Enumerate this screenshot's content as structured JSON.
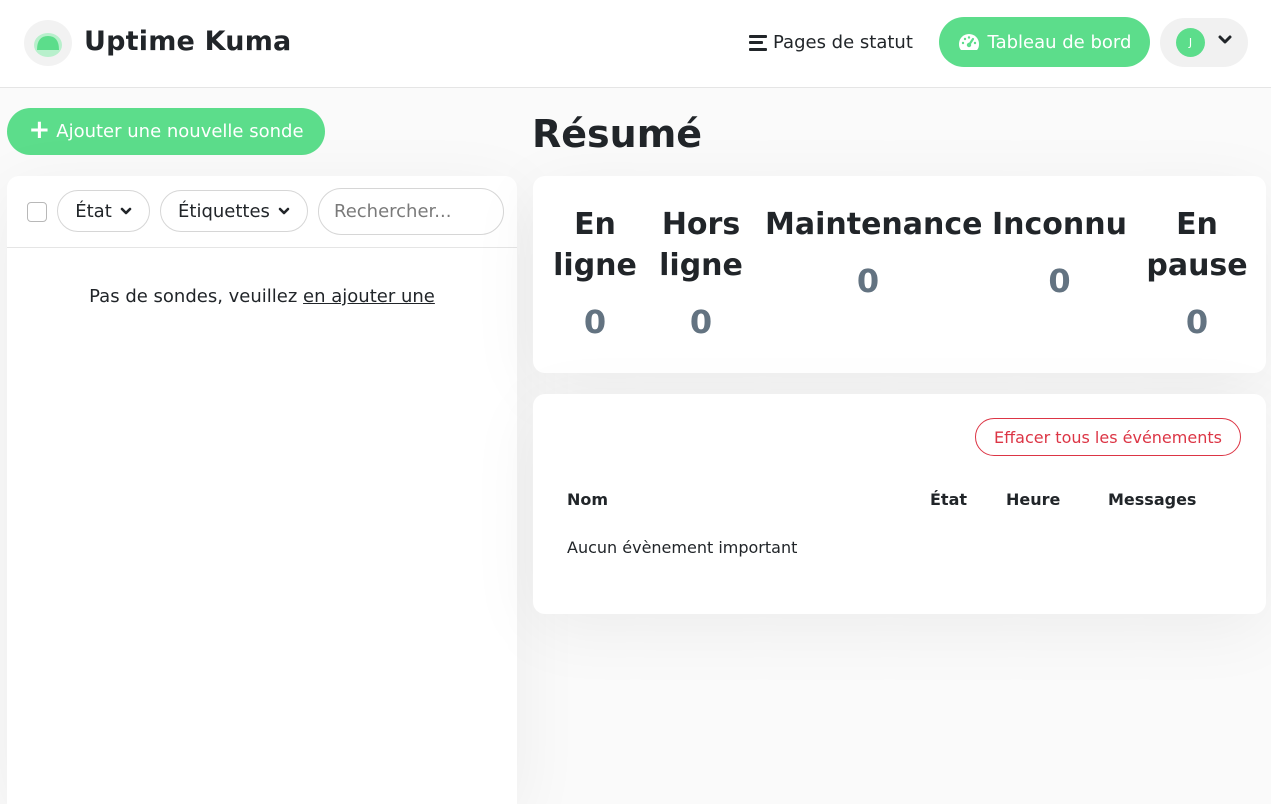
{
  "header": {
    "app_title": "Uptime Kuma",
    "status_pages_label": "Pages de statut",
    "dashboard_label": "Tableau de bord",
    "avatar_initial": "J"
  },
  "sidebar": {
    "add_monitor_label": "Ajouter une nouvelle sonde",
    "filter_state_label": "État",
    "filter_tags_label": "Étiquettes",
    "search_placeholder": "Rechercher...",
    "empty_text": "Pas de sondes, veuillez ",
    "empty_link": "en ajouter une"
  },
  "summary": {
    "title": "Résumé",
    "stats": [
      {
        "label_line1": "En",
        "label_line2": "ligne",
        "value": "0"
      },
      {
        "label_line1": "Hors",
        "label_line2": "ligne",
        "value": "0"
      },
      {
        "label_line1": "Maintenance",
        "label_line2": "",
        "value": "0"
      },
      {
        "label_line1": "Inconnu",
        "label_line2": "",
        "value": "0"
      },
      {
        "label_line1": "En",
        "label_line2": "pause",
        "value": "0"
      }
    ]
  },
  "events": {
    "clear_label": "Effacer tous les événements",
    "columns": [
      "Nom",
      "État",
      "Heure",
      "Messages"
    ],
    "empty_text": "Aucun évènement important"
  },
  "colors": {
    "primary": "#5cdd8b",
    "danger": "#dc3545",
    "stat_value": "#637381"
  },
  "icons": {
    "logo": "uptime-kuma-logo",
    "status_pages": "list-icon",
    "dashboard": "tachometer-icon",
    "profile_chevron": "chevron-down-icon",
    "add": "plus-icon"
  }
}
